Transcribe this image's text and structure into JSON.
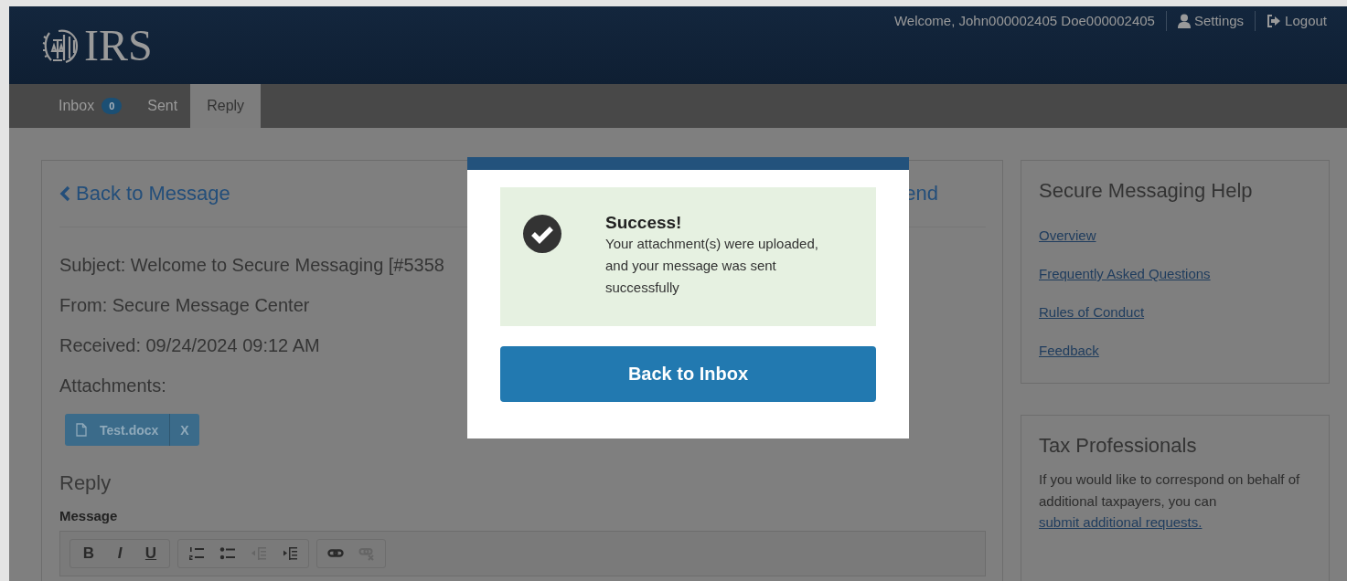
{
  "header": {
    "logo": "IRS",
    "welcome": "Welcome, John000002405 Doe000002405",
    "links": [
      {
        "label": "Settings",
        "kind": "user"
      },
      {
        "label": "Logout",
        "kind": "logout"
      }
    ]
  },
  "tabs": [
    {
      "label": "Inbox",
      "badge": "0",
      "selected": false
    },
    {
      "label": "Sent",
      "selected": false
    },
    {
      "label": "Reply",
      "selected": true
    }
  ],
  "message": {
    "back_link": "Back to Message",
    "send_link": "end",
    "subject": "Subject: Welcome to Secure Messaging [#5358",
    "from": "From: Secure Message Center",
    "received": "Received: 09/24/2024 09:12 AM",
    "attachments_label": "Attachments:",
    "attachments": [
      {
        "name": "Test.docx",
        "remove": "X"
      }
    ],
    "reply_heading": "Reply",
    "message_label": "Message",
    "toolbar": [
      [
        {
          "label": "B",
          "kind": "bold",
          "disabled": false
        },
        {
          "label": "I",
          "kind": "italic",
          "disabled": false
        },
        {
          "label": "U",
          "kind": "underline",
          "disabled": false
        }
      ],
      [
        {
          "kind": "numbered",
          "disabled": false
        },
        {
          "kind": "bullets",
          "disabled": false
        },
        {
          "kind": "outdent",
          "disabled": true
        },
        {
          "kind": "indent",
          "disabled": false
        }
      ],
      [
        {
          "kind": "link",
          "disabled": false
        },
        {
          "kind": "unlink",
          "disabled": true
        }
      ]
    ]
  },
  "help": {
    "title": "Secure Messaging Help",
    "links": [
      "Overview",
      "Frequently Asked Questions",
      "Rules of Conduct",
      "Feedback"
    ]
  },
  "tax": {
    "title": "Tax Professionals",
    "text": "If you would like to correspond on behalf of additional taxpayers, you can",
    "link": "submit additional requests."
  },
  "modal": {
    "title": "Success!",
    "text": "Your attachment(s) were uploaded, and your message was sent successfully",
    "button": "Back to Inbox"
  }
}
